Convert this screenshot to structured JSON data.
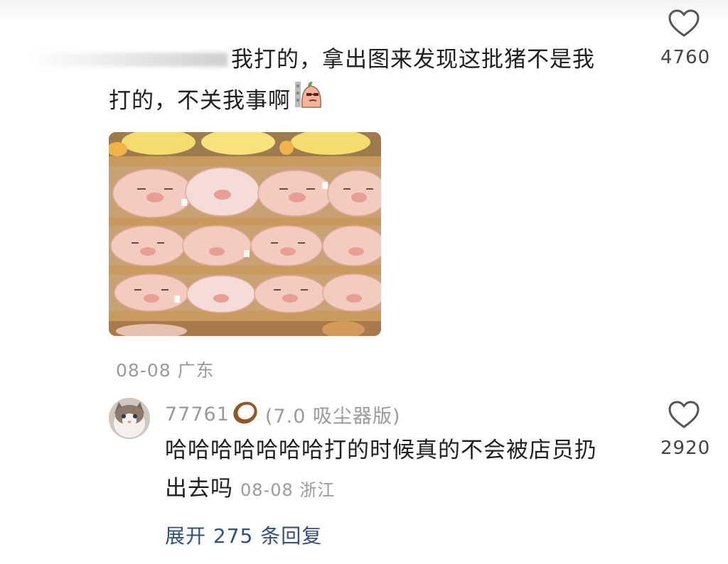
{
  "comment1": {
    "line1": "我打的，拿出图来发现这批猪不是我",
    "line2": "打的，不关我事啊",
    "emoji": "sticker-icon",
    "likes": "4760",
    "date": "08-08",
    "location": "广东"
  },
  "reply": {
    "username": "77761",
    "badge_emoji": "coconut-icon",
    "device": "(7.0 吸尘器版)",
    "line1": "哈哈哈哈哈哈哈打的时候真的不会被店员扔",
    "line2": "出去吗",
    "date": "08-08",
    "location": "浙江",
    "likes": "2920"
  },
  "expand_label": "展开 275 条回复",
  "colors": {
    "text": "#1f1f1f",
    "meta": "#9a9a9a",
    "link": "#33507a",
    "pig": "#f3c9c0",
    "shelf": "#b98a52"
  }
}
